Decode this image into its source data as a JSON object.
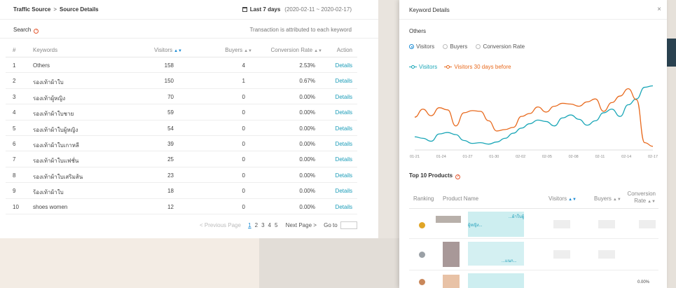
{
  "header": {
    "breadcrumb_root": "Traffic Source",
    "breadcrumb_sep": ">",
    "breadcrumb_current": "Source Details",
    "date_label": "Last 7 days",
    "date_range": "(2020-02-11 ~ 2020-02-17)"
  },
  "search": {
    "label": "Search",
    "note": "Transaction is attributed to each keyword"
  },
  "table": {
    "columns": {
      "num": "#",
      "keyword": "Keywords",
      "visitors": "Visitors",
      "buyers": "Buyers",
      "conversion": "Conversion Rate",
      "action": "Action"
    },
    "rows": [
      {
        "num": "1",
        "keyword": "Others",
        "visitors": "158",
        "buyers": "4",
        "conversion": "2.53%",
        "action": "Details"
      },
      {
        "num": "2",
        "keyword": "รองเท้าผ้าใบ",
        "visitors": "150",
        "buyers": "1",
        "conversion": "0.67%",
        "action": "Details"
      },
      {
        "num": "3",
        "keyword": "รองเท้าผู้หญิง",
        "visitors": "70",
        "buyers": "0",
        "conversion": "0.00%",
        "action": "Details"
      },
      {
        "num": "4",
        "keyword": "รองเท้าผ้าใบชาย",
        "visitors": "59",
        "buyers": "0",
        "conversion": "0.00%",
        "action": "Details"
      },
      {
        "num": "5",
        "keyword": "รองเท้าผ้าใบผู้หญิง",
        "visitors": "54",
        "buyers": "0",
        "conversion": "0.00%",
        "action": "Details"
      },
      {
        "num": "6",
        "keyword": "รองเท้าผ้าใบเกาหลี",
        "visitors": "39",
        "buyers": "0",
        "conversion": "0.00%",
        "action": "Details"
      },
      {
        "num": "7",
        "keyword": "รองเท้าผ้าใบแฟชั่น",
        "visitors": "25",
        "buyers": "0",
        "conversion": "0.00%",
        "action": "Details"
      },
      {
        "num": "8",
        "keyword": "รองเท้าผ้าใบเสริมส้น",
        "visitors": "23",
        "buyers": "0",
        "conversion": "0.00%",
        "action": "Details"
      },
      {
        "num": "9",
        "keyword": "ร้องเท้าผ้าใบ",
        "visitors": "18",
        "buyers": "0",
        "conversion": "0.00%",
        "action": "Details"
      },
      {
        "num": "10",
        "keyword": "shoes women",
        "visitors": "12",
        "buyers": "0",
        "conversion": "0.00%",
        "action": "Details"
      }
    ]
  },
  "pager": {
    "prev": "< Previous Page",
    "pages": [
      "1",
      "2",
      "3",
      "4",
      "5"
    ],
    "current": "1",
    "next": "Next Page >",
    "goto": "Go to"
  },
  "modal": {
    "title": "Keyword Details",
    "close": "×",
    "keyword": "Others",
    "radios": [
      "Visitors",
      "Buyers",
      "Conversion Rate"
    ],
    "selected_radio": "Visitors",
    "legend": [
      "Visitors",
      "Visitors 30 days before"
    ],
    "top_title": "Top 10 Products",
    "product_columns": {
      "ranking": "Ranking",
      "name": "Product Name",
      "visitors": "Visitors",
      "buyers": "Buyers",
      "conversion_l1": "Conversion",
      "conversion_l2": "Rate"
    },
    "product_rows": [
      {
        "name": "...ผ้าใบผู้",
        "sub": "ผู้หญิง..."
      },
      {
        "name": "",
        "sub": "...แนก..."
      },
      {
        "name": "",
        "sub": "",
        "conversion": "0.00%"
      }
    ]
  },
  "colors": {
    "visitors": "#1aa6b7",
    "visitors_30": "#e86a1e",
    "link": "#1a9cb8",
    "accent": "#1a8bd4"
  },
  "chart_data": {
    "type": "line",
    "x": [
      "01-21",
      "01-24",
      "01-27",
      "01-30",
      "02-02",
      "02-05",
      "02-08",
      "02-11",
      "02-14",
      "02-17"
    ],
    "x_points": 30,
    "ylim": [
      0,
      10
    ],
    "grid": false,
    "legend_position": "top-left",
    "series": [
      {
        "name": "Visitors",
        "values": [
          1.8,
          1.6,
          1.2,
          2.2,
          2.4,
          2.1,
          1.3,
          0.9,
          1.0,
          0.8,
          1.1,
          1.6,
          2.3,
          3.0,
          3.6,
          4.1,
          3.9,
          3.3,
          4.4,
          4.8,
          4.2,
          3.4,
          4.0,
          5.1,
          5.6,
          4.6,
          6.2,
          7.0,
          8.6,
          8.8
        ]
      },
      {
        "name": "Visitors 30 days before",
        "values": [
          4.5,
          5.6,
          4.7,
          5.8,
          5.5,
          3.3,
          5.1,
          5.4,
          5.3,
          4.0,
          2.6,
          2.8,
          3.1,
          4.6,
          5.0,
          5.9,
          5.2,
          6.0,
          6.4,
          6.3,
          6.0,
          6.6,
          7.0,
          5.3,
          6.5,
          7.4,
          8.4,
          6.9,
          1.0,
          0.5
        ]
      }
    ]
  }
}
